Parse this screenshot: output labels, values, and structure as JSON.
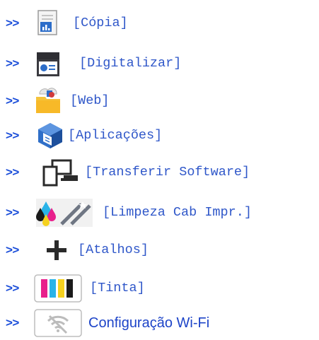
{
  "arrow": ">>",
  "items": [
    {
      "label": "[Cópia]",
      "icon": "copy-icon"
    },
    {
      "label": "[Digitalizar]",
      "icon": "scanner-icon"
    },
    {
      "label": "[Web]",
      "icon": "web-folder-icon"
    },
    {
      "label": "[Aplicações]",
      "icon": "apps-cube-icon"
    },
    {
      "label": "[Transferir Software]",
      "icon": "devices-icon"
    },
    {
      "label": "[Limpeza Cab Impr.]",
      "icon": "head-cleaning-icon"
    },
    {
      "label": "[Atalhos]",
      "icon": "plus-icon"
    },
    {
      "label": "[Tinta]",
      "icon": "ink-icon"
    },
    {
      "label": "Configuração Wi-Fi",
      "icon": "wifi-off-icon"
    }
  ],
  "colors": {
    "link": "#2f57c9",
    "arrow": "#1a4dd9"
  }
}
